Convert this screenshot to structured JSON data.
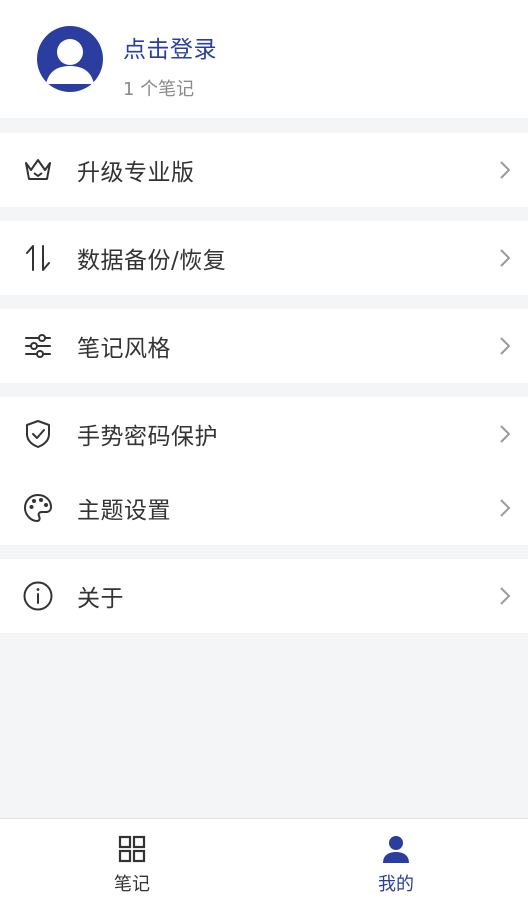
{
  "profile": {
    "login_text": "点击登录",
    "note_count": "1 个笔记"
  },
  "menu": {
    "upgrade": "升级专业版",
    "backup": "数据备份/恢复",
    "note_style": "笔记风格",
    "gesture_password": "手势密码保护",
    "theme": "主题设置",
    "about": "关于"
  },
  "tabbar": {
    "notes": "笔记",
    "mine": "我的"
  },
  "colors": {
    "accent": "#2b3ea0",
    "icon": "#333333",
    "chevron": "#9a9a9a",
    "background": "#f4f5f7"
  }
}
